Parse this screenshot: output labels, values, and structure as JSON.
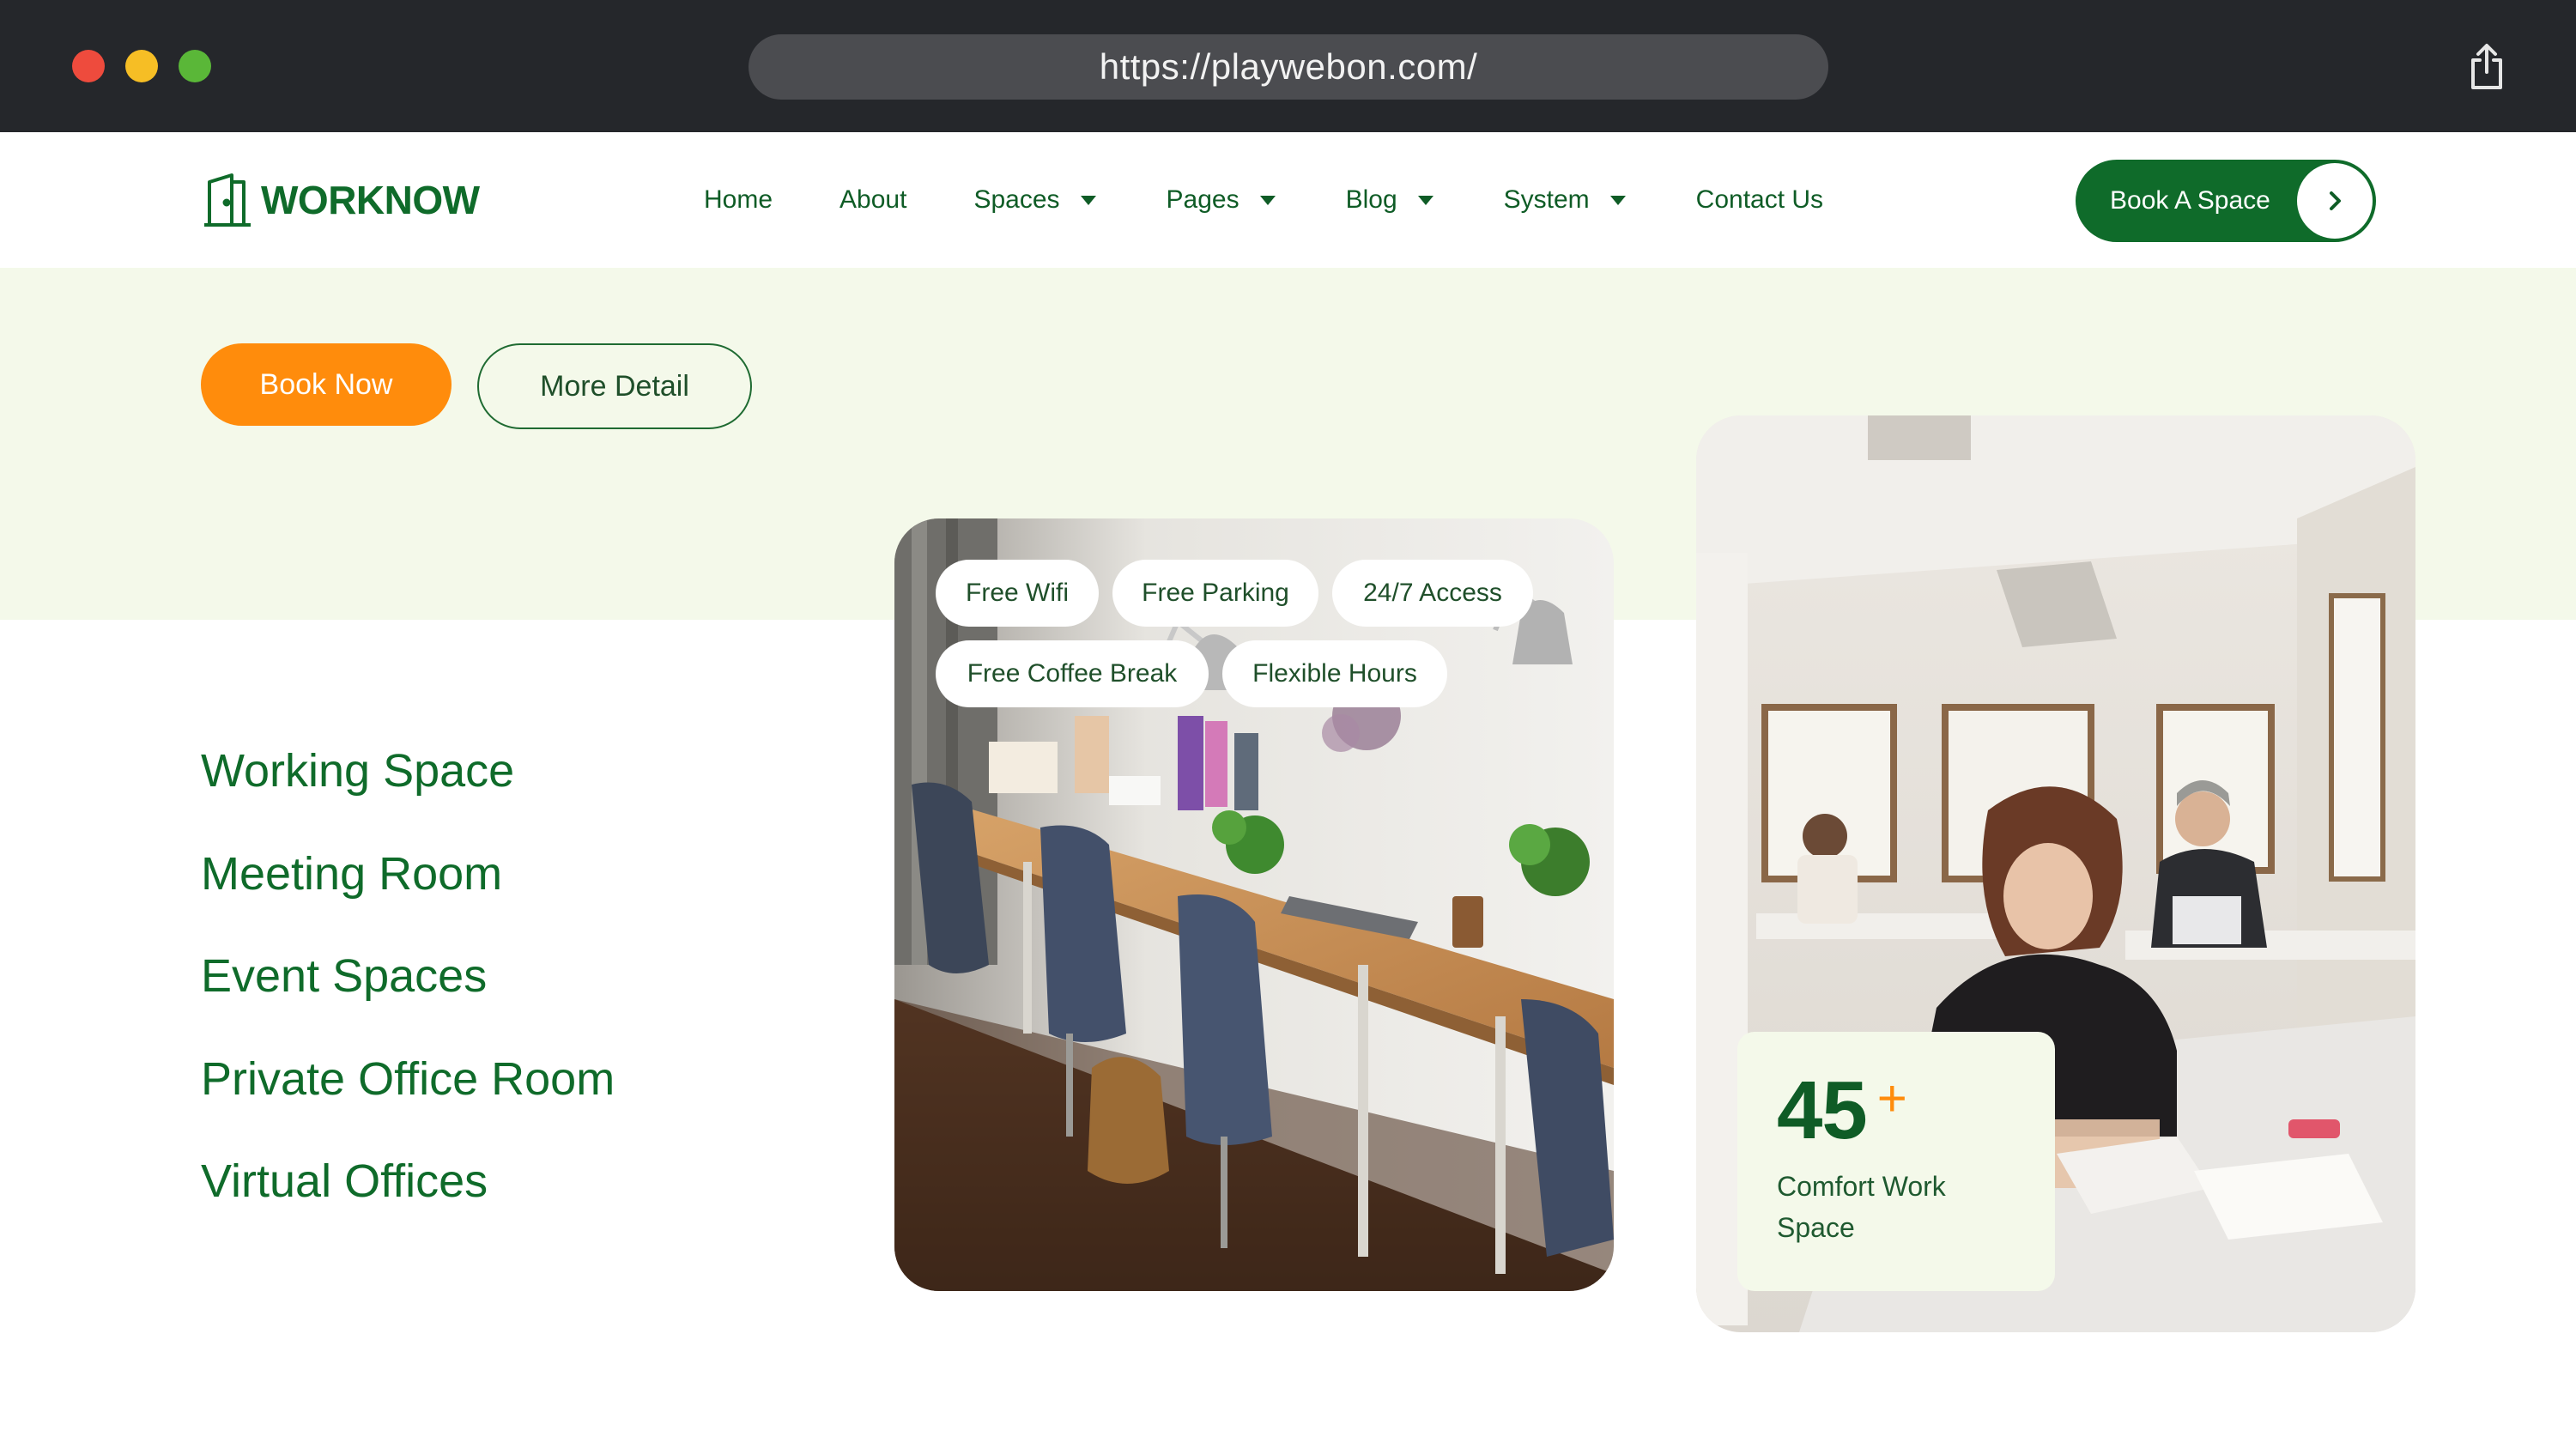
{
  "browser": {
    "url": "https://playwebon.com/"
  },
  "header": {
    "logo_text": "WORKNOW",
    "nav": [
      {
        "label": "Home",
        "has_dropdown": false
      },
      {
        "label": "About",
        "has_dropdown": false
      },
      {
        "label": "Spaces",
        "has_dropdown": true
      },
      {
        "label": "Pages",
        "has_dropdown": true
      },
      {
        "label": "Blog",
        "has_dropdown": true
      },
      {
        "label": "System",
        "has_dropdown": true
      },
      {
        "label": "Contact Us",
        "has_dropdown": false
      }
    ],
    "cta_label": "Book A Space"
  },
  "hero": {
    "primary_button": "Book Now",
    "secondary_button": "More Detail"
  },
  "spaces": [
    "Working Space",
    "Meeting Room",
    "Event Spaces",
    "Private Office Room",
    "Virtual Offices"
  ],
  "amenities": [
    "Free Wifi",
    "Free Parking",
    "24/7 Access",
    "Free Coffee Break",
    "Flexible Hours"
  ],
  "stat": {
    "value": "45",
    "suffix": "+",
    "label": "Comfort Work Space"
  },
  "colors": {
    "brand_green": "#0f6b2a",
    "accent_orange": "#ff8c0c",
    "hero_band": "#f4f9ea",
    "chrome_dark": "#25272b"
  },
  "icons": {
    "share": "share-icon",
    "logo": "door-logo-icon",
    "cta_arrow": "chevron-right-icon",
    "dropdown": "caret-down-icon"
  }
}
